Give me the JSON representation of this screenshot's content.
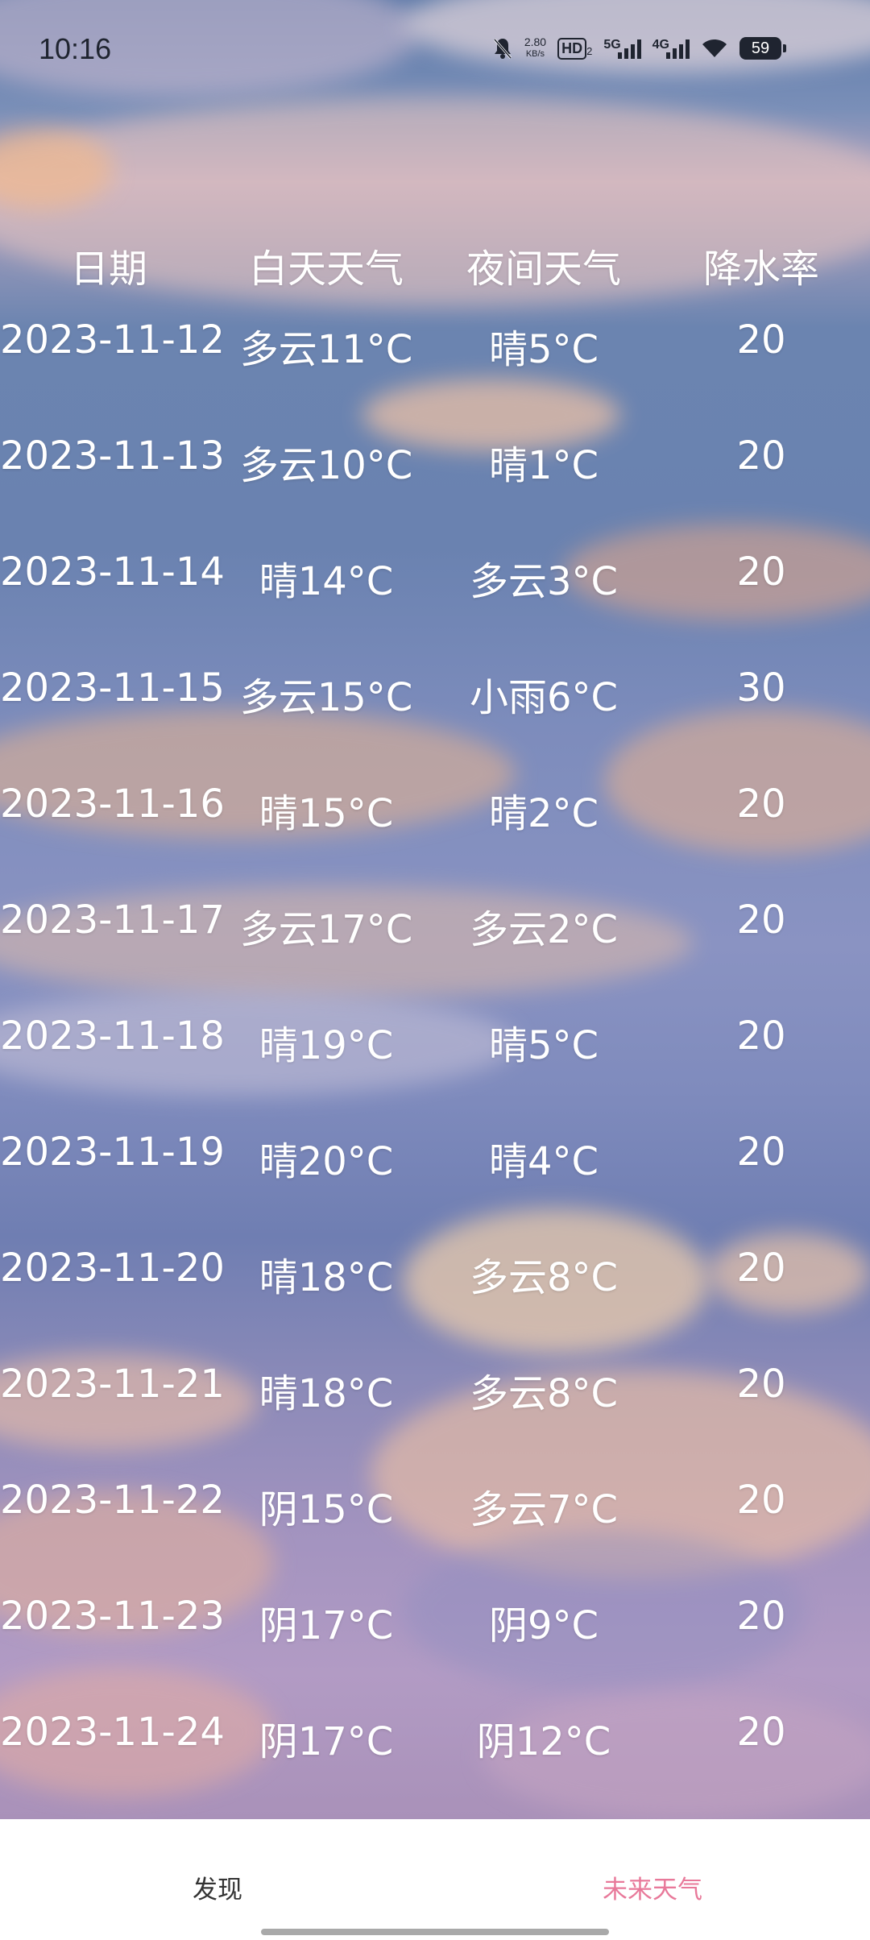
{
  "status_bar": {
    "time": "10:16",
    "net_speed_value": "2.80",
    "net_speed_unit": "KB/s",
    "hd_label": "HD",
    "hd_sub": "2",
    "sig1_label": "5G",
    "sig2_label": "4G",
    "battery": "59"
  },
  "table": {
    "headers": [
      "日期",
      "白天天气",
      "夜间天气",
      "降水率"
    ],
    "rows": [
      {
        "date": "2023-11-12",
        "day": "多云11°C",
        "night": "晴5°C",
        "precip": "20"
      },
      {
        "date": "2023-11-13",
        "day": "多云10°C",
        "night": "晴1°C",
        "precip": "20"
      },
      {
        "date": "2023-11-14",
        "day": "晴14°C",
        "night": "多云3°C",
        "precip": "20"
      },
      {
        "date": "2023-11-15",
        "day": "多云15°C",
        "night": "小雨6°C",
        "precip": "30"
      },
      {
        "date": "2023-11-16",
        "day": "晴15°C",
        "night": "晴2°C",
        "precip": "20"
      },
      {
        "date": "2023-11-17",
        "day": "多云17°C",
        "night": "多云2°C",
        "precip": "20"
      },
      {
        "date": "2023-11-18",
        "day": "晴19°C",
        "night": "晴5°C",
        "precip": "20"
      },
      {
        "date": "2023-11-19",
        "day": "晴20°C",
        "night": "晴4°C",
        "precip": "20"
      },
      {
        "date": "2023-11-20",
        "day": "晴18°C",
        "night": "多云8°C",
        "precip": "20"
      },
      {
        "date": "2023-11-21",
        "day": "晴18°C",
        "night": "多云8°C",
        "precip": "20"
      },
      {
        "date": "2023-11-22",
        "day": "阴15°C",
        "night": "多云7°C",
        "precip": "20"
      },
      {
        "date": "2023-11-23",
        "day": "阴17°C",
        "night": "阴9°C",
        "precip": "20"
      },
      {
        "date": "2023-11-24",
        "day": "阴17°C",
        "night": "阴12°C",
        "precip": "20"
      }
    ]
  },
  "bottom_nav": {
    "discover_label": "发现",
    "forecast_label": "未来天气",
    "active_color": "#e8799a"
  }
}
